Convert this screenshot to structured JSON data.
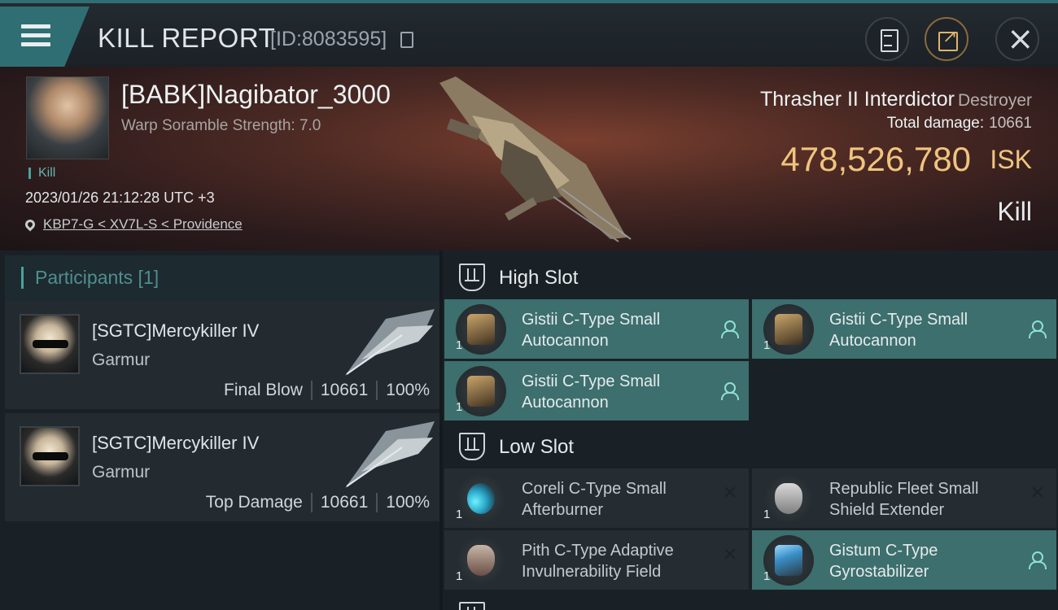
{
  "header": {
    "title": "KILL REPORT",
    "report_id": "[ID:8083595]"
  },
  "victim": {
    "name": "[BABK]Nagibator_3000",
    "warp_scramble": "Warp Soramble Strength: 7.0",
    "tag": "Kill",
    "timestamp": "2023/01/26 21:12:28 UTC +3",
    "location": "KBP7-G < XV7L-S < Providence"
  },
  "ship": {
    "name": "Thrasher II Interdictor",
    "class": "Destroyer",
    "total_damage_label": "Total damage:",
    "total_damage": "10661",
    "isk_value": "478,526,780",
    "isk_unit": "ISK",
    "result": "Kill"
  },
  "participants": {
    "title": "Participants [1]",
    "items": [
      {
        "name": "[SGTC]Mercykiller IV",
        "ship": "Garmur",
        "role": "Final Blow",
        "damage": "10661",
        "percent": "100%"
      },
      {
        "name": "[SGTC]Mercykiller IV",
        "ship": "Garmur",
        "role": "Top Damage",
        "damage": "10661",
        "percent": "100%"
      }
    ]
  },
  "fitting": {
    "high_slot": {
      "title": "High Slot",
      "modules": [
        {
          "name_line1": "Gistii C-Type Small",
          "name_line2": "Autocannon",
          "qty": "1",
          "status": "fitted"
        },
        {
          "name_line1": "Gistii C-Type Small",
          "name_line2": "Autocannon",
          "qty": "1",
          "status": "fitted"
        },
        {
          "name_line1": "Gistii C-Type Small",
          "name_line2": "Autocannon",
          "qty": "1",
          "status": "fitted"
        }
      ]
    },
    "low_slot": {
      "title": "Low Slot",
      "modules": [
        {
          "name_line1": "Coreli C-Type Small",
          "name_line2": "Afterburner",
          "qty": "1",
          "status": "destroyed"
        },
        {
          "name_line1": "Republic Fleet Small",
          "name_line2": "Shield Extender",
          "qty": "1",
          "status": "destroyed"
        },
        {
          "name_line1": "Pith C-Type Adaptive",
          "name_line2": "Invulnerability Field",
          "qty": "1",
          "status": "destroyed"
        },
        {
          "name_line1": "Gistum C-Type",
          "name_line2": "Gyrostabilizer",
          "qty": "1",
          "status": "fitted"
        }
      ]
    }
  },
  "icons": {
    "menu": "hamburger-icon",
    "copy": "copy-icon",
    "clipboard": "clipboard-icon",
    "share": "share-icon",
    "close": "close-icon",
    "location": "map-pin-icon",
    "pilot": "user-icon",
    "destroyed": "x-icon"
  },
  "colors": {
    "accent": "#2f6f73",
    "isk": "#f0c47e",
    "fitted": "#3c6f6d",
    "destroyed": "#252d32"
  }
}
